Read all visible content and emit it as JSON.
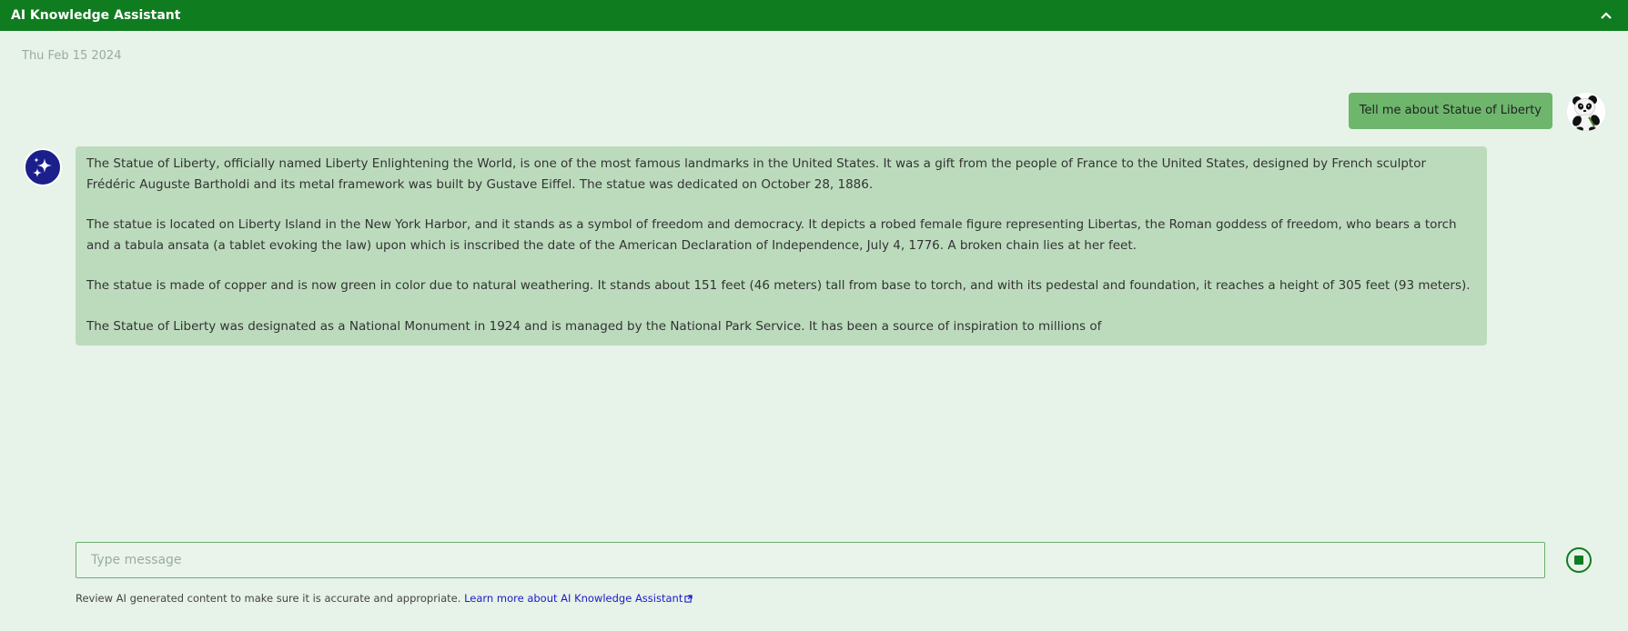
{
  "header": {
    "title": "AI Knowledge Assistant",
    "collapse_icon": "chevron-up-icon"
  },
  "conversation": {
    "date": "Thu Feb 15 2024",
    "user_message": "Tell me about Statue of Liberty",
    "user_avatar": "panda-avatar",
    "bot_avatar": "sparkles-icon",
    "bot_paragraphs": [
      "The Statue of Liberty, officially named Liberty Enlightening the World, is one of the most famous landmarks in the United States. It was a gift from the people of France to the United States, designed by French sculptor Frédéric Auguste Bartholdi and its metal framework was built by Gustave Eiffel. The statue was dedicated on October 28, 1886.",
      "The statue is located on Liberty Island in the New York Harbor, and it stands as a symbol of freedom and democracy. It depicts a robed female figure representing Libertas, the Roman goddess of freedom, who bears a torch and a tabula ansata (a tablet evoking the law) upon which is inscribed the date of the American Declaration of Independence, July 4, 1776. A broken chain lies at her feet.",
      "The statue is made of copper and is now green in color due to natural weathering. It stands about 151 feet (46 meters) tall from base to torch, and with its pedestal and foundation, it reaches a height of 305 feet (93 meters).",
      "The Statue of Liberty was designated as a National Monument in 1924 and is managed by the National Park Service. It has been a source of inspiration to millions of"
    ]
  },
  "composer": {
    "placeholder": "Type message",
    "value": "",
    "stop_icon": "stop-icon"
  },
  "footer": {
    "disclaimer": "Review AI generated content to make sure it is accurate and appropriate.",
    "learn_more": "Learn more about AI Knowledge Assistant",
    "external_icon": "external-link-icon"
  },
  "colors": {
    "header_bg": "#107c20",
    "page_bg": "#e7f2e8",
    "user_bubble": "#6db66c",
    "bot_bubble": "#bcdbbd",
    "bot_avatar_bg": "#1a1f8c",
    "link": "#1a1acc"
  }
}
